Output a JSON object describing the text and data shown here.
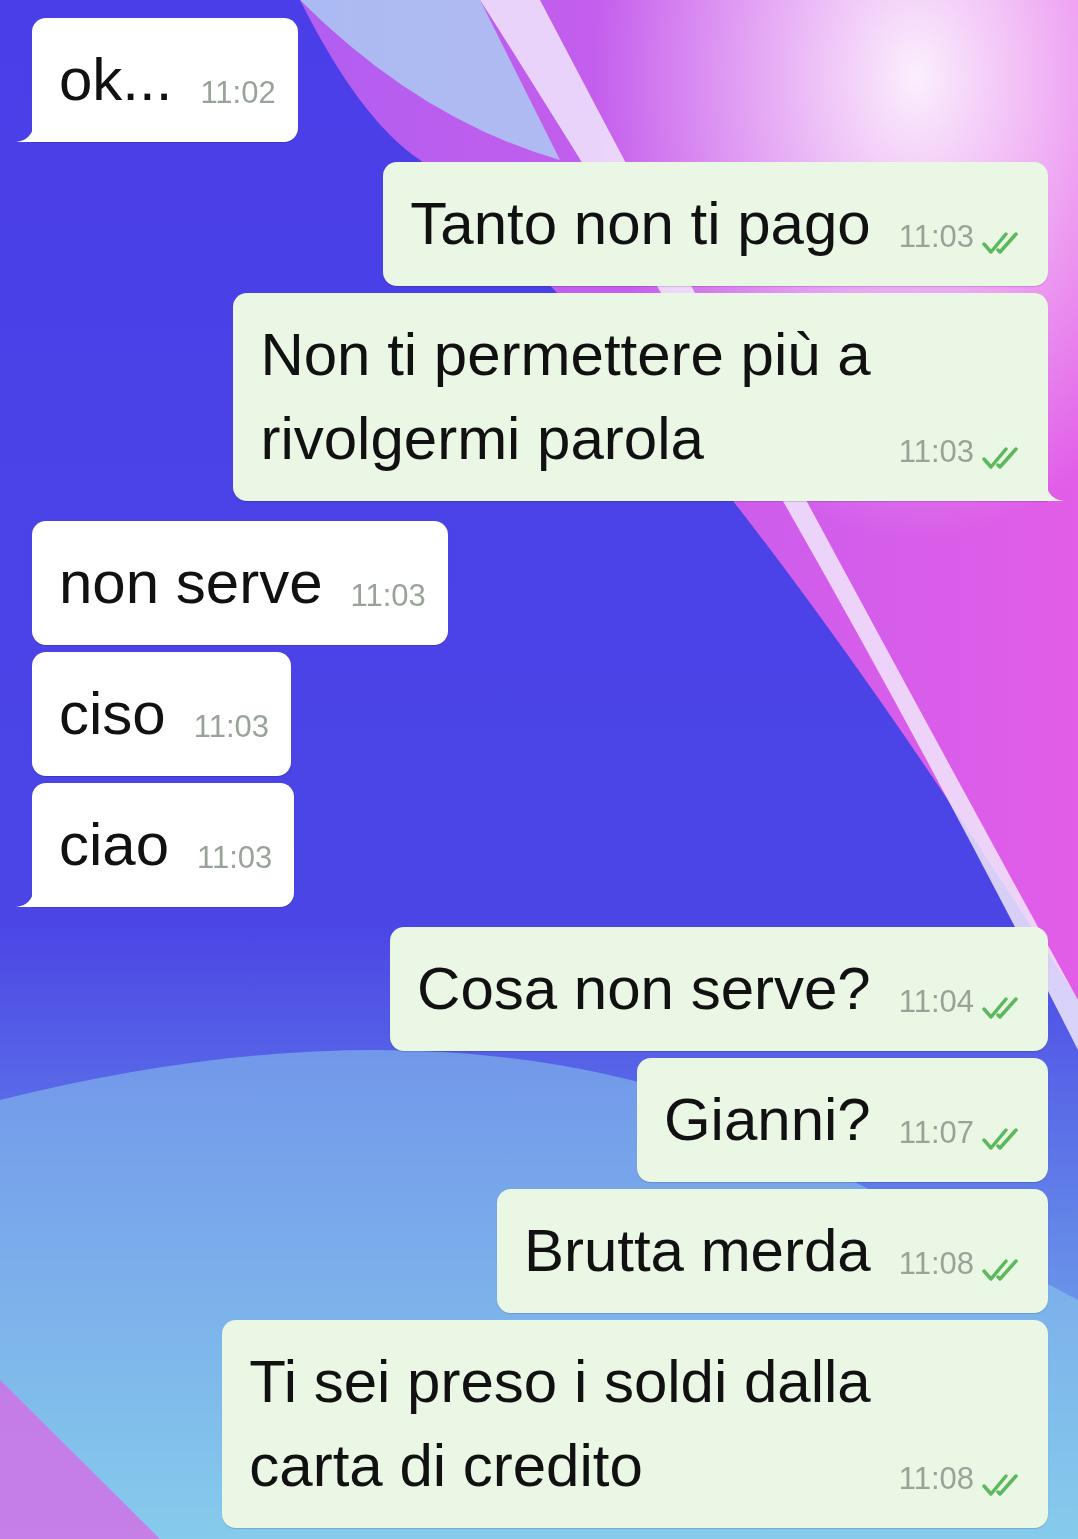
{
  "messages": [
    {
      "kind": "incoming",
      "lines": [
        "ok..."
      ],
      "time": "11:02",
      "tail": true
    },
    {
      "kind": "outgoing",
      "lines": [
        "Tanto non ti pago"
      ],
      "time": "11:03",
      "tail": false
    },
    {
      "kind": "outgoing",
      "lines": [
        "Non ti permettere più a",
        "rivolgermi parola"
      ],
      "time": "11:03",
      "tail": true
    },
    {
      "kind": "incoming",
      "lines": [
        "non serve"
      ],
      "time": "11:03",
      "tail": false
    },
    {
      "kind": "incoming",
      "lines": [
        "ciso"
      ],
      "time": "11:03",
      "tail": false
    },
    {
      "kind": "incoming",
      "lines": [
        "ciao"
      ],
      "time": "11:03",
      "tail": true
    },
    {
      "kind": "outgoing",
      "lines": [
        "Cosa non serve?"
      ],
      "time": "11:04",
      "tail": false
    },
    {
      "kind": "outgoing",
      "lines": [
        "Gianni?"
      ],
      "time": "11:07",
      "tail": false
    },
    {
      "kind": "outgoing",
      "lines": [
        "Brutta merda"
      ],
      "time": "11:08",
      "tail": false
    },
    {
      "kind": "outgoing",
      "lines": [
        "Ti sei preso i soldi dalla",
        "carta di credito"
      ],
      "time": "11:08",
      "tail": false
    }
  ]
}
